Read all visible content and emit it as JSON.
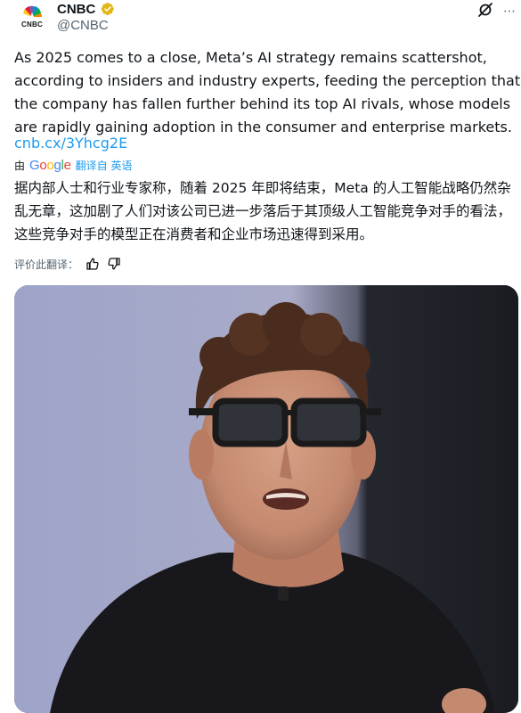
{
  "account": {
    "name": "CNBC",
    "handle": "@CNBC",
    "avatar_label": "CNBC",
    "verified": true,
    "verified_color": "#e2b719"
  },
  "header_icons": {
    "grok": "grok-icon",
    "more": "more-icon"
  },
  "tweet": {
    "text": "As 2025 comes to a close, Meta’s AI strategy remains scattershot, according to insiders and industry experts, feeding the perception that the company has fallen further behind its top AI rivals, whose models are rapidly gaining adoption in the consumer and enterprise markets.",
    "link": "cnb.cx/3Yhcg2E"
  },
  "translation": {
    "prefix": "由",
    "provider": "Google",
    "action": "翻译自 英语",
    "text": "据内部人士和行业专家称，随着 2025 年即将结束，Meta 的人工智能战略仍然杂乱无章，这加剧了人们对该公司已进一步落后于其顶级人工智能竞争对手的看法，这些竞争对手的模型正在消费者和企业市场迅速得到采用。",
    "rate_label": "评价此翻译："
  },
  "colors": {
    "text": "#0f1419",
    "secondary": "#536471",
    "link": "#1d9bf0"
  }
}
